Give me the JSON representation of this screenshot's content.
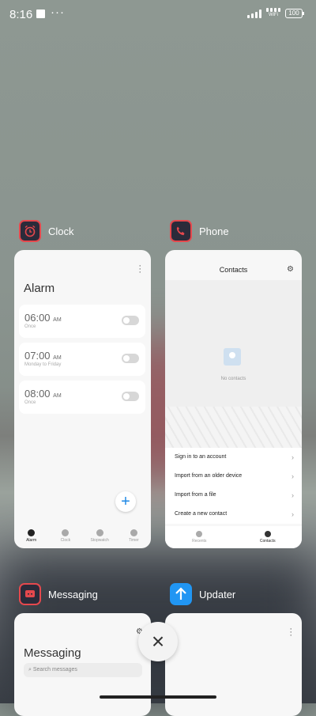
{
  "status": {
    "time": "8:16",
    "dots": "···",
    "wifi_label": "WiFi",
    "battery": "100"
  },
  "apps": {
    "clock": {
      "name": "Clock",
      "header_title": "Alarm",
      "alarms": [
        {
          "time": "06:00",
          "ampm": "AM",
          "detail": "Once"
        },
        {
          "time": "07:00",
          "ampm": "AM",
          "detail": "Monday to Friday"
        },
        {
          "time": "08:00",
          "ampm": "AM",
          "detail": "Once"
        }
      ],
      "fab": "+",
      "tabs": [
        "Alarm",
        "Clock",
        "Stopwatch",
        "Timer"
      ]
    },
    "phone": {
      "name": "Phone",
      "header_title": "Contacts",
      "empty_text": "No contacts",
      "menu": [
        "Sign in to an account",
        "Import from an older device",
        "Import from a file",
        "Create a new contact"
      ],
      "tabs": [
        "Recents",
        "Contacts"
      ]
    },
    "messaging": {
      "name": "Messaging",
      "header_title": "Messaging",
      "search_placeholder": "Search messages"
    },
    "updater": {
      "name": "Updater"
    }
  },
  "colors": {
    "clock_icon": "#e5484d",
    "phone_icon": "#e5484d",
    "messaging_icon": "#e5484d",
    "updater_icon": "#2196f3",
    "accent": "#1e88e5"
  },
  "close_button": "×"
}
